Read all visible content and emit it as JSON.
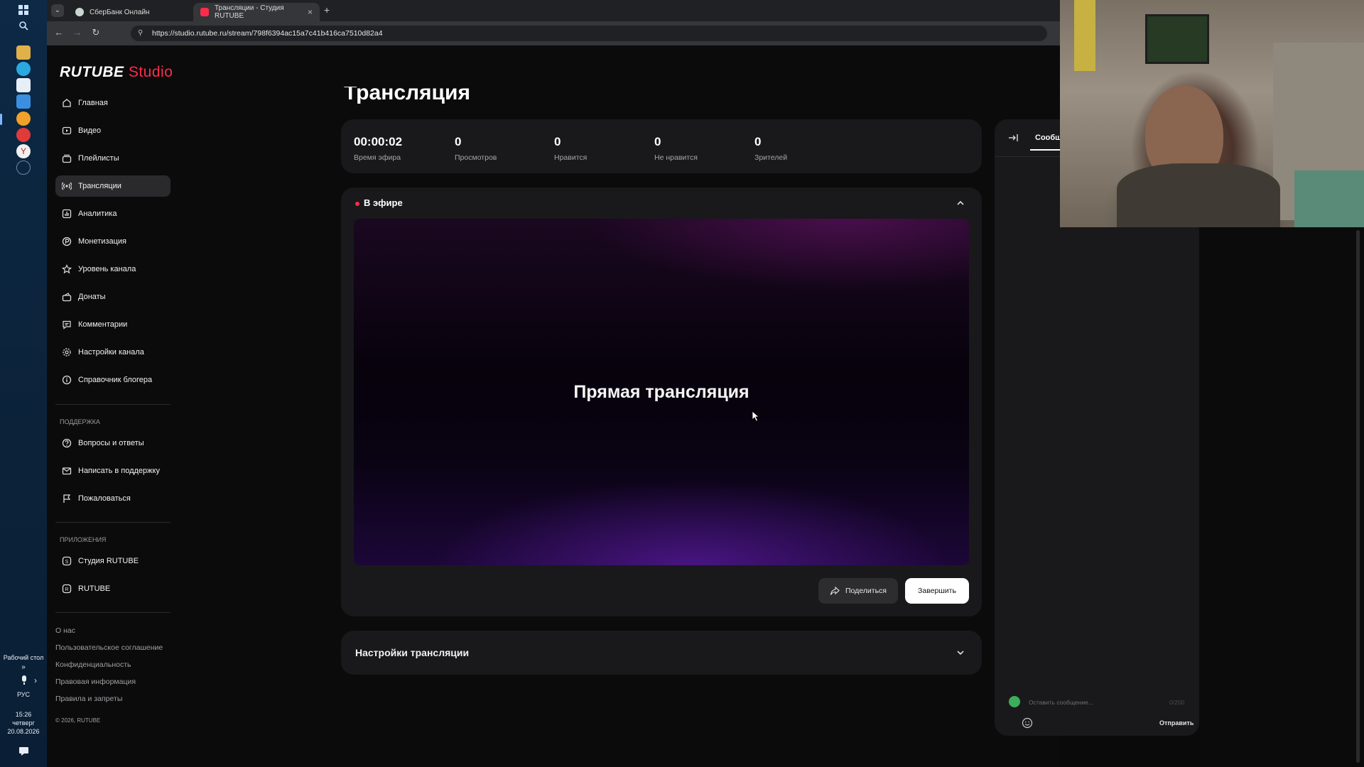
{
  "taskbar": {
    "desktop_label": "Рабочий стол",
    "lang": "РУС",
    "time": "15:26",
    "weekday": "четверг",
    "date": "20.08.2026"
  },
  "browser": {
    "tabs": [
      {
        "title": "СберБанк Онлайн"
      },
      {
        "title": "Трансляции - Студия RUTUBE"
      }
    ],
    "url": "https://studio.rutube.ru/stream/798f6394ac15a7c41b416ca7510d82a4"
  },
  "logo": {
    "brand": "RUTUBE",
    "product": "Studio"
  },
  "sidebar": {
    "items": [
      {
        "label": "Главная",
        "icon": "home-icon"
      },
      {
        "label": "Видео",
        "icon": "video-icon"
      },
      {
        "label": "Плейлисты",
        "icon": "playlist-icon"
      },
      {
        "label": "Трансляции",
        "icon": "broadcast-icon"
      },
      {
        "label": "Аналитика",
        "icon": "analytics-icon"
      },
      {
        "label": "Монетизация",
        "icon": "monetization-icon"
      },
      {
        "label": "Уровень канала",
        "icon": "star-icon"
      },
      {
        "label": "Донаты",
        "icon": "donate-icon"
      },
      {
        "label": "Комментарии",
        "icon": "comment-icon"
      },
      {
        "label": "Настройки канала",
        "icon": "gear-icon"
      },
      {
        "label": "Справочник блогера",
        "icon": "info-icon"
      }
    ],
    "support_heading": "ПОДДЕРЖКА",
    "support_items": [
      {
        "label": "Вопросы и ответы",
        "icon": "question-icon"
      },
      {
        "label": "Написать в поддержку",
        "icon": "mail-icon"
      },
      {
        "label": "Пожаловаться",
        "icon": "flag-icon"
      }
    ],
    "apps_heading": "ПРИЛОЖЕНИЯ",
    "apps_items": [
      {
        "label": "Студия RUTUBE",
        "icon": "studio-app-icon"
      },
      {
        "label": "RUTUBE",
        "icon": "rutube-app-icon"
      }
    ],
    "footer_links": [
      "О нас",
      "Пользовательское соглашение",
      "Конфиденциальность",
      "Правовая информация",
      "Правила и запреты"
    ],
    "copyright": "© 2026, RUTUBE"
  },
  "page": {
    "title": "Трансляция",
    "stats": [
      {
        "value": "00:00:02",
        "label": "Время эфира"
      },
      {
        "value": "0",
        "label": "Просмотров"
      },
      {
        "value": "0",
        "label": "Нравится"
      },
      {
        "value": "0",
        "label": "Не нравится"
      },
      {
        "value": "0",
        "label": "Зрителей"
      }
    ],
    "live": {
      "status": "В эфире",
      "player_text": "Прямая трансляция",
      "share_label": "Поделиться",
      "finish_label": "Завершить"
    },
    "settings_title": "Настройки трансляции"
  },
  "chat": {
    "tab_label": "Сообщ",
    "input_placeholder": "Оставить сообщение...",
    "counter": "0/200",
    "send_label": "Отправить"
  },
  "colors": {
    "accent": "#ff2b4b",
    "card": "#19191b",
    "background": "#0b0b0c"
  }
}
